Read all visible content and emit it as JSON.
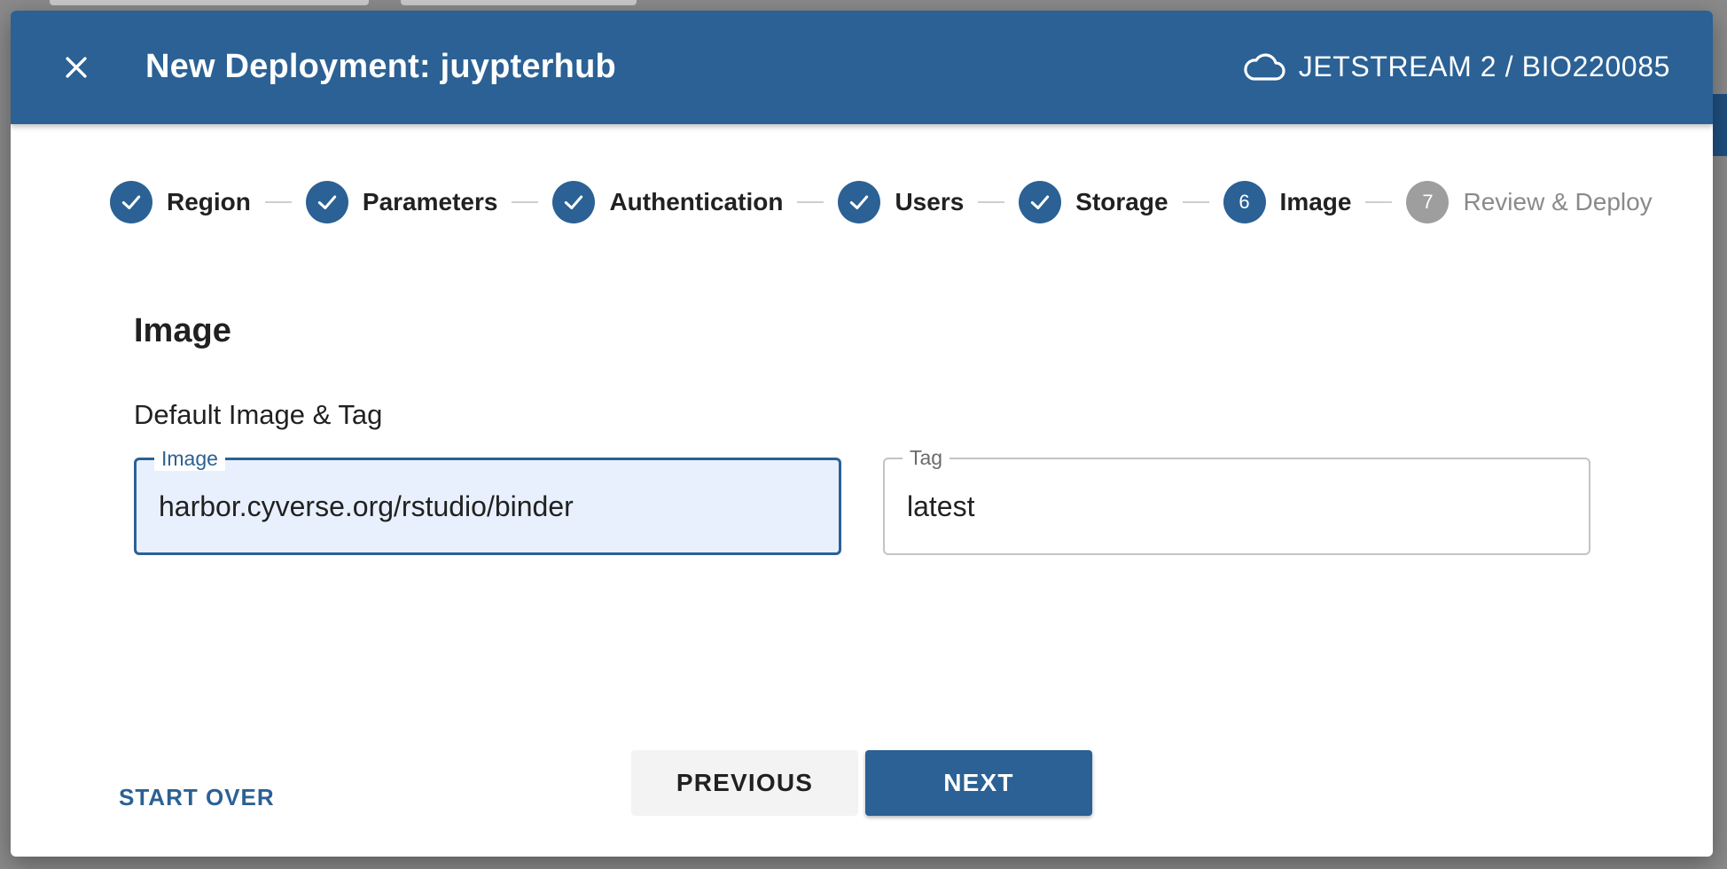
{
  "header": {
    "title": "New Deployment: juypterhub",
    "cloud_label": "JETSTREAM 2 / BIO220085",
    "close_icon": "close-icon",
    "cloud_icon": "cloud-icon"
  },
  "stepper": {
    "steps": [
      {
        "label": "Region",
        "state": "complete",
        "icon": "check-icon"
      },
      {
        "label": "Parameters",
        "state": "complete",
        "icon": "check-icon"
      },
      {
        "label": "Authentication",
        "state": "complete",
        "icon": "check-icon"
      },
      {
        "label": "Users",
        "state": "complete",
        "icon": "check-icon"
      },
      {
        "label": "Storage",
        "state": "complete",
        "icon": "check-icon"
      },
      {
        "label": "Image",
        "state": "active",
        "number": "6"
      },
      {
        "label": "Review & Deploy",
        "state": "pending",
        "number": "7"
      }
    ]
  },
  "main": {
    "section_title": "Image",
    "subheading": "Default Image & Tag",
    "image_field": {
      "label": "Image",
      "value": "harbor.cyverse.org/rstudio/binder"
    },
    "tag_field": {
      "label": "Tag",
      "value": "latest"
    }
  },
  "footer": {
    "start_over": "START OVER",
    "previous": "PREVIOUS",
    "next": "NEXT"
  },
  "colors": {
    "primary": "#2b6194",
    "pending": "#9e9e9e",
    "active_field_bg": "#e8f0fd"
  }
}
